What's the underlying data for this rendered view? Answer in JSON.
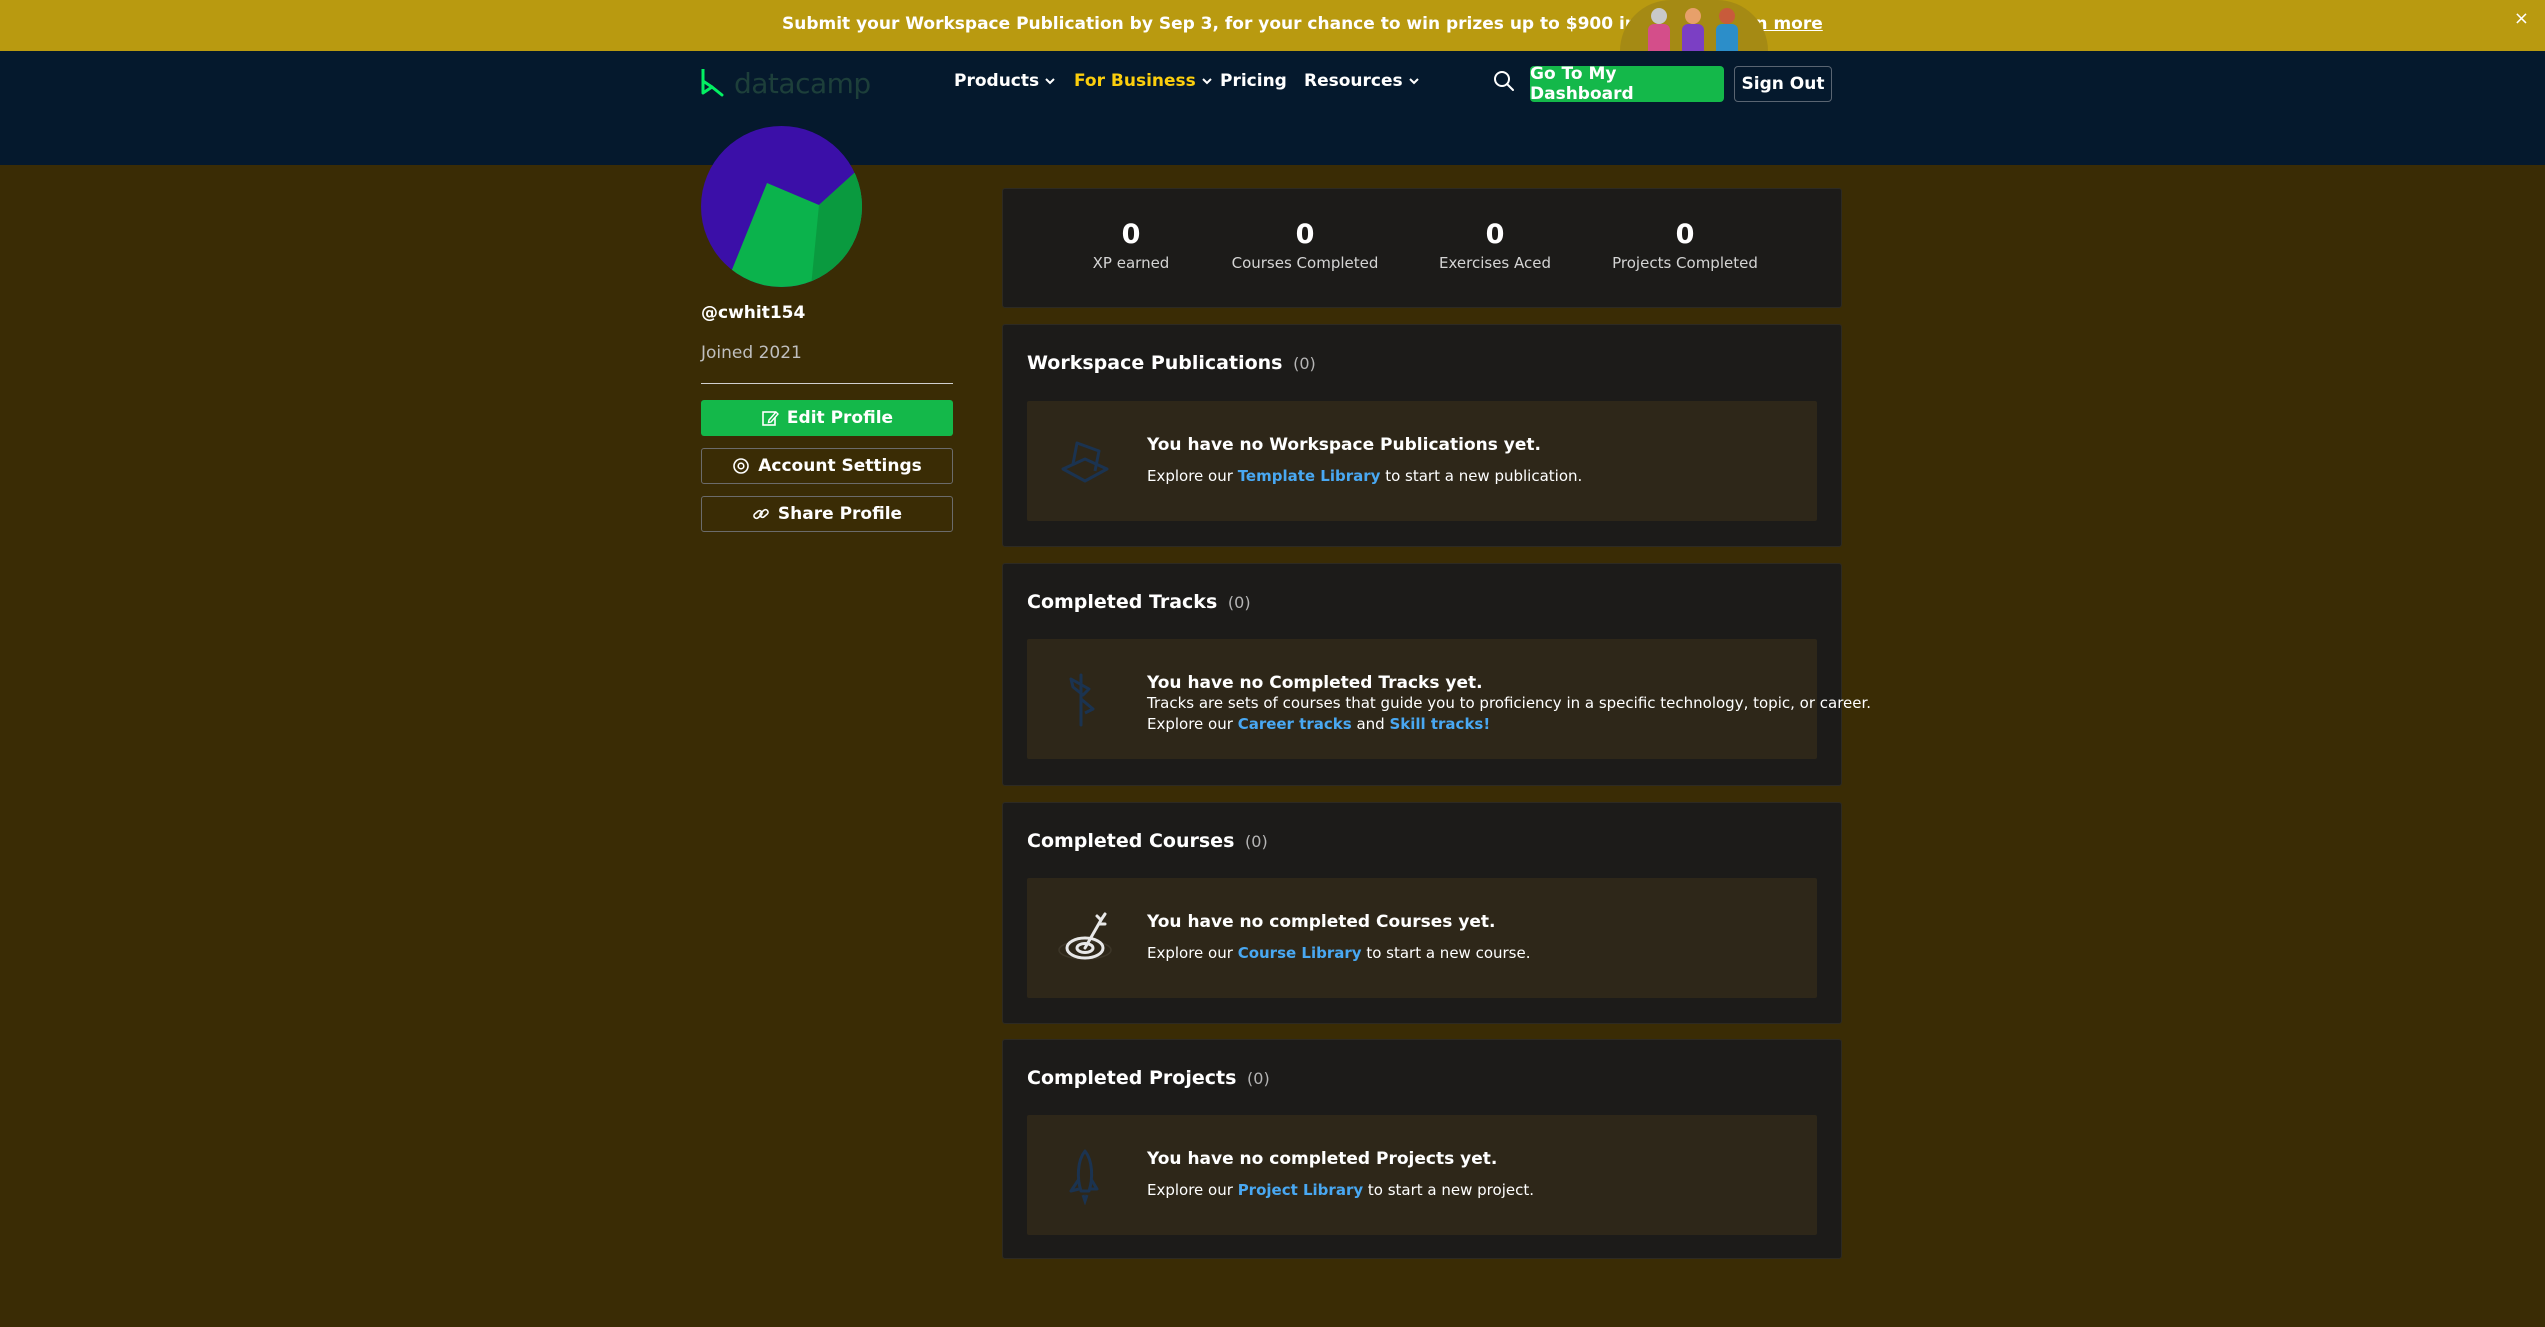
{
  "banner": {
    "text": "Submit your Workspace Publication by Sep 3, for your chance to win prizes up to $900 in value.",
    "link": "Learn more",
    "close": "×"
  },
  "nav": {
    "logo_text": "datacamp",
    "items": [
      {
        "label": "Products",
        "has_dropdown": true
      },
      {
        "label": "For Business",
        "has_dropdown": true
      },
      {
        "label": "Pricing",
        "has_dropdown": false
      },
      {
        "label": "Resources",
        "has_dropdown": true
      }
    ],
    "search_icon": "search-icon",
    "dashboard_button": "Go To My Dashboard",
    "signout_button": "Sign Out"
  },
  "profile": {
    "username": "@cwhit154",
    "joined": "Joined 2021",
    "edit_button": "Edit Profile",
    "settings_button": "Account Settings",
    "share_button": "Share Profile"
  },
  "stats": [
    {
      "value": "0",
      "label": "XP earned"
    },
    {
      "value": "0",
      "label": "Courses Completed"
    },
    {
      "value": "0",
      "label": "Exercises Aced"
    },
    {
      "value": "0",
      "label": "Projects Completed"
    }
  ],
  "sections": {
    "publications": {
      "title": "Workspace Publications",
      "count": "(0)",
      "empty_title": "You have no Workspace Publications yet.",
      "desc_prefix": "Explore our ",
      "desc_link": "Template Library",
      "desc_suffix": " to start a new publication."
    },
    "tracks": {
      "title": "Completed Tracks",
      "count": "(0)",
      "empty_title": "You have no Completed Tracks yet.",
      "desc_line1": "Tracks are sets of courses that guide you to proficiency in a specific technology, topic, or career.",
      "desc_prefix": "Explore our ",
      "desc_link1": "Career tracks",
      "desc_mid": " and ",
      "desc_link2": "Skill tracks",
      "desc_suffix": "!"
    },
    "courses": {
      "title": "Completed Courses",
      "count": "(0)",
      "empty_title": "You have no completed Courses yet.",
      "desc_prefix": "Explore our ",
      "desc_link": "Course Library",
      "desc_suffix": " to start a new course."
    },
    "projects": {
      "title": "Completed Projects",
      "count": "(0)",
      "empty_title": "You have no completed Projects yet.",
      "desc_prefix": "Explore our ",
      "desc_link": "Project Library",
      "desc_suffix": " to start a new project."
    }
  },
  "colors": {
    "banner": "#b99a10",
    "nav": "#05192d",
    "page": "#3a2c05",
    "accent_green": "#14b84a",
    "business_yellow": "#fcce0d",
    "link_blue": "#49a8f2",
    "avatar_purple": "#3b0fa8",
    "avatar_green": "#0bb34c"
  }
}
